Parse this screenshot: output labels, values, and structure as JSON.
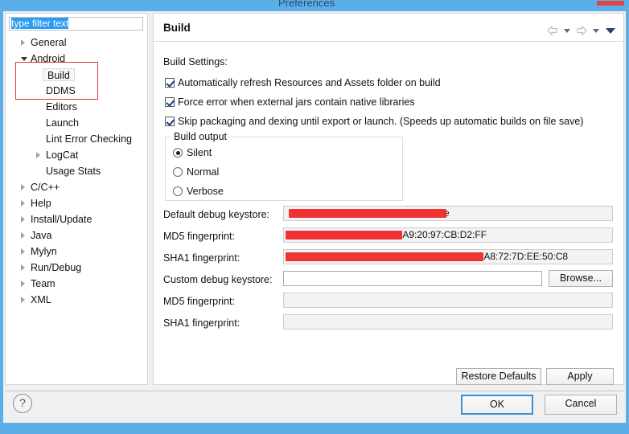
{
  "window": {
    "title": "Preferences"
  },
  "sidebar": {
    "filter": {
      "value": "type filter text",
      "placeholder": "type filter text"
    },
    "items": [
      {
        "label": "General",
        "level": 1,
        "twisty": "collapsed"
      },
      {
        "label": "Android",
        "level": 1,
        "twisty": "expanded"
      },
      {
        "label": "Build",
        "level": 2,
        "twisty": "none",
        "selected": true
      },
      {
        "label": "DDMS",
        "level": 2,
        "twisty": "none"
      },
      {
        "label": "Editors",
        "level": 2,
        "twisty": "none"
      },
      {
        "label": "Launch",
        "level": 2,
        "twisty": "none"
      },
      {
        "label": "Lint Error Checking",
        "level": 2,
        "twisty": "none"
      },
      {
        "label": "LogCat",
        "level": 2,
        "twisty": "collapsed"
      },
      {
        "label": "Usage Stats",
        "level": 2,
        "twisty": "none"
      },
      {
        "label": "C/C++",
        "level": 1,
        "twisty": "collapsed"
      },
      {
        "label": "Help",
        "level": 1,
        "twisty": "collapsed"
      },
      {
        "label": "Install/Update",
        "level": 1,
        "twisty": "collapsed"
      },
      {
        "label": "Java",
        "level": 1,
        "twisty": "collapsed"
      },
      {
        "label": "Mylyn",
        "level": 1,
        "twisty": "collapsed"
      },
      {
        "label": "Run/Debug",
        "level": 1,
        "twisty": "collapsed"
      },
      {
        "label": "Team",
        "level": 1,
        "twisty": "collapsed"
      },
      {
        "label": "XML",
        "level": 1,
        "twisty": "collapsed"
      }
    ],
    "highlight_color": "#e0393e"
  },
  "content": {
    "title": "Build",
    "settings_label": "Build Settings:",
    "checkboxes": [
      {
        "label": "Automatically refresh Resources and Assets folder on build",
        "checked": true
      },
      {
        "label": "Force error when external jars contain native libraries",
        "checked": true
      },
      {
        "label": "Skip packaging and dexing until export or launch. (Speeds up automatic builds on file save)",
        "checked": true
      }
    ],
    "build_output": {
      "group_title": "Build output",
      "options": [
        {
          "label": "Silent",
          "selected": true
        },
        {
          "label": "Normal",
          "selected": false
        },
        {
          "label": "Verbose",
          "selected": false
        }
      ]
    },
    "fields": [
      {
        "label": "Default debug keystore:",
        "value": "e",
        "redacted": true,
        "readonly": true
      },
      {
        "label": "MD5 fingerprint:",
        "value": ":A9:20:97:CB:D2:FF",
        "redacted": true,
        "readonly": true
      },
      {
        "label": "SHA1 fingerprint:",
        "value": ":A8:72:7D:EE:50:C8",
        "redacted": true,
        "readonly": true
      },
      {
        "label": "Custom debug keystore:",
        "value": "",
        "redacted": false,
        "readonly": false
      },
      {
        "label": "MD5 fingerprint:",
        "value": "",
        "redacted": false,
        "readonly": true
      },
      {
        "label": "SHA1 fingerprint:",
        "value": "",
        "redacted": false,
        "readonly": true
      }
    ],
    "browse_label": "Browse...",
    "restore_defaults_label": "Restore Defaults",
    "apply_label": "Apply"
  },
  "footer": {
    "help_glyph": "?",
    "ok_label": "OK",
    "cancel_label": "Cancel"
  }
}
